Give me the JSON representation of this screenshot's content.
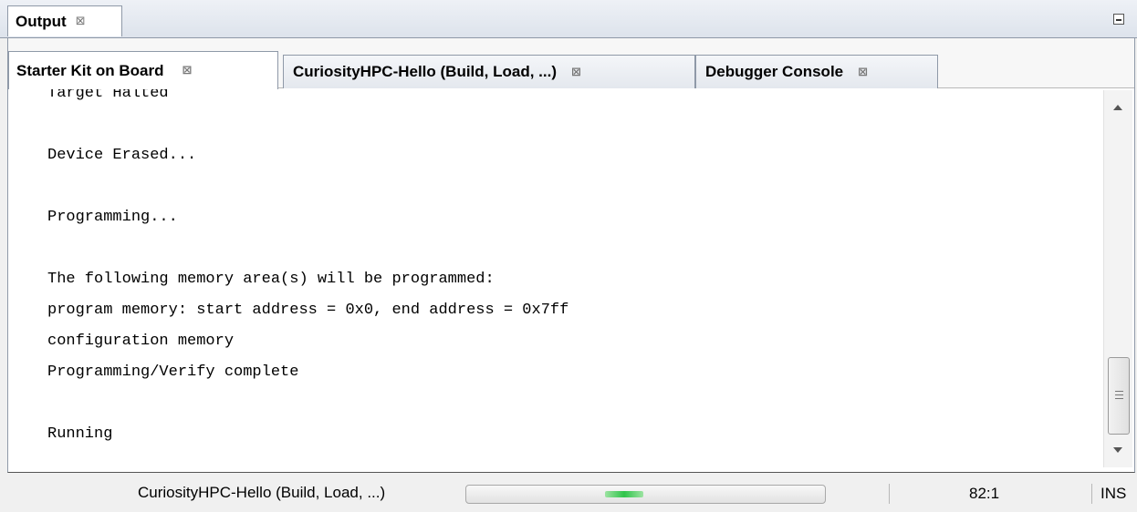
{
  "output_window": {
    "title": "Output",
    "close_glyph": "⊠",
    "minimize_icon": "minimize-icon"
  },
  "tabs": [
    {
      "label": "Starter Kit on Board",
      "active": true,
      "close_glyph": "⊠"
    },
    {
      "label": "CuriosityHPC-Hello (Build, Load, ...)",
      "active": false,
      "close_glyph": "⊠"
    },
    {
      "label": "Debugger Console",
      "active": false,
      "close_glyph": "⊠"
    }
  ],
  "console": {
    "lines": [
      "Target Halted",
      "",
      "Device Erased...",
      "",
      "Programming...",
      "",
      "The following memory area(s) will be programmed:",
      "program memory: start address = 0x0, end address = 0x7ff",
      "configuration memory",
      "Programming/Verify complete",
      "",
      "Running"
    ]
  },
  "status_bar": {
    "task": "CuriosityHPC-Hello (Build, Load, ...)",
    "progress": "indeterminate",
    "position": "82:1",
    "mode": "INS"
  },
  "colors": {
    "progress_green": "#2fc44a",
    "border": "#8f99a8"
  }
}
